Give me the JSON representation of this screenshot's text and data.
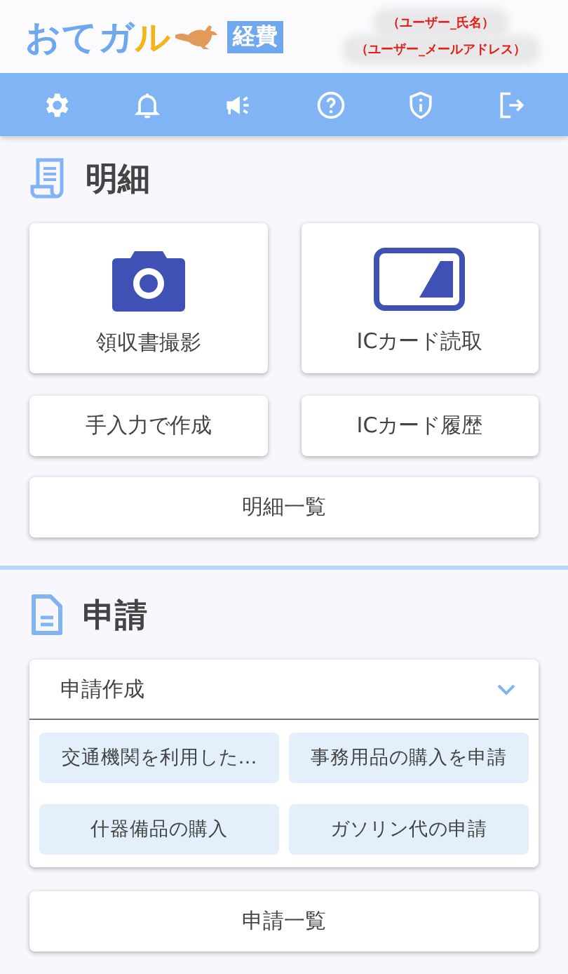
{
  "header": {
    "logo": [
      {
        "text": "おてガ",
        "color": "#6fa8ee"
      },
      {
        "text": "ル",
        "color": "#f4b51c"
      }
    ],
    "badge": "経費",
    "user_name": "（ユーザー_氏名）",
    "user_email": "（ユーザー_メールアドレス）"
  },
  "nav": [
    {
      "kind": "settings"
    },
    {
      "kind": "bell"
    },
    {
      "kind": "megaphone"
    },
    {
      "kind": "help"
    },
    {
      "kind": "shield"
    },
    {
      "kind": "logout"
    }
  ],
  "details": {
    "title": "明細",
    "tiles": [
      {
        "kind": "camera",
        "label": "領収書撮影"
      },
      {
        "kind": "card",
        "label": "ICカード読取"
      }
    ],
    "buttons": [
      "手入力で作成",
      "ICカード履歴"
    ],
    "list_button": "明細一覧"
  },
  "requests": {
    "title": "申請",
    "dropdown": {
      "label": "申請作成",
      "expanded": true,
      "options": [
        "交通機関を利用した…",
        "事務用品の購入を申請",
        "什器備品の購入",
        "ガソリン代の申請"
      ]
    },
    "list_button": "申請一覧"
  }
}
